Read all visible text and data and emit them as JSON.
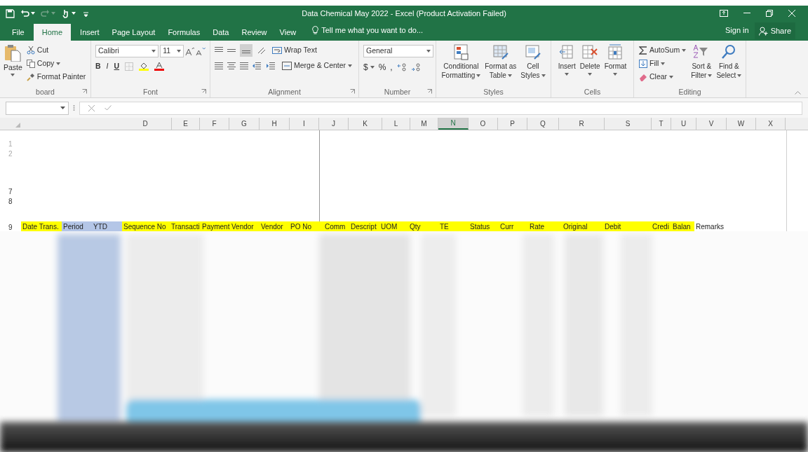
{
  "window": {
    "title": "Data Chemical May 2022 - Excel (Product Activation Failed)"
  },
  "quick_access": [
    {
      "kind": "save",
      "disabled": false
    },
    {
      "kind": "undo",
      "disabled": false
    },
    {
      "kind": "redo",
      "disabled": true
    },
    {
      "kind": "touch",
      "disabled": false
    },
    {
      "kind": "customize",
      "disabled": false
    }
  ],
  "tabs": [
    {
      "label": "File",
      "selected": false
    },
    {
      "label": "Home",
      "selected": true
    },
    {
      "label": "Insert",
      "selected": false
    },
    {
      "label": "Page Layout",
      "selected": false
    },
    {
      "label": "Formulas",
      "selected": false
    },
    {
      "label": "Data",
      "selected": false
    },
    {
      "label": "Review",
      "selected": false
    },
    {
      "label": "View",
      "selected": false
    }
  ],
  "tell_me": "Tell me what you want to do...",
  "sign_in": "Sign in",
  "share": "Share",
  "ribbon": {
    "clipboard": {
      "paste": "Paste",
      "cut": "Cut",
      "copy": "Copy",
      "format_painter": "Format Painter",
      "label": "board"
    },
    "font": {
      "font_name": "Calibri",
      "font_size": "11",
      "bold": "B",
      "italic": "I",
      "underline": "U",
      "label": "Font"
    },
    "alignment": {
      "wrap_text": "Wrap Text",
      "merge_center": "Merge & Center",
      "label": "Alignment"
    },
    "number": {
      "format": "General",
      "currency": "$",
      "percent": "%",
      "comma": ",",
      "label": "Number"
    },
    "styles": {
      "buttons": [
        {
          "kind": "conditional",
          "lines": [
            "Conditional",
            "Formatting"
          ],
          "dropdown": true
        },
        {
          "kind": "table",
          "lines": [
            "Format as",
            "Table"
          ],
          "dropdown": true
        },
        {
          "kind": "cellstyles",
          "lines": [
            "Cell",
            "Styles"
          ],
          "dropdown": true
        }
      ],
      "label": "Styles"
    },
    "cells": {
      "buttons": [
        {
          "kind": "insert",
          "lines": [
            "Insert"
          ],
          "dropdown": true
        },
        {
          "kind": "delete",
          "lines": [
            "Delete"
          ],
          "dropdown": true
        },
        {
          "kind": "format",
          "lines": [
            "Format"
          ],
          "dropdown": true
        }
      ],
      "label": "Cells"
    },
    "editing": {
      "autosum": "AutoSum",
      "fill": "Fill",
      "clear": "Clear",
      "buttons": [
        {
          "kind": "sort",
          "lines": [
            "Sort &",
            "Filter"
          ],
          "dropdown": true
        },
        {
          "kind": "find",
          "lines": [
            "Find &",
            "Select"
          ],
          "dropdown": true
        }
      ],
      "label": "Editing"
    }
  },
  "columns": [
    {
      "label": "D",
      "selected": false
    },
    {
      "label": "E",
      "selected": false
    },
    {
      "label": "F",
      "selected": false
    },
    {
      "label": "G",
      "selected": false
    },
    {
      "label": "H",
      "selected": false
    },
    {
      "label": "I",
      "selected": false
    },
    {
      "label": "J",
      "selected": false
    },
    {
      "label": "K",
      "selected": false
    },
    {
      "label": "L",
      "selected": false
    },
    {
      "label": "M",
      "selected": false
    },
    {
      "label": "N",
      "selected": true
    },
    {
      "label": "O",
      "selected": false
    },
    {
      "label": "P",
      "selected": false
    },
    {
      "label": "Q",
      "selected": false
    },
    {
      "label": "R",
      "selected": false
    },
    {
      "label": "S",
      "selected": false
    },
    {
      "label": "T",
      "selected": false
    },
    {
      "label": "U",
      "selected": false
    },
    {
      "label": "V",
      "selected": false
    },
    {
      "label": "W",
      "selected": false
    },
    {
      "label": "X",
      "selected": false
    }
  ],
  "row_numbers": [
    "1",
    "2",
    "7",
    "8",
    "9"
  ],
  "header_row": [
    {
      "text": "Date Trans.",
      "color": "#ffff00"
    },
    {
      "text": "Period",
      "color": "#b4c6e7"
    },
    {
      "text": "YTD",
      "color": "#b4c6e7"
    },
    {
      "text": "Sequence No",
      "color": "#ffff00"
    },
    {
      "text": "Transacti",
      "color": "#ffff00"
    },
    {
      "text": "Payment",
      "color": "#ffff00"
    },
    {
      "text": "Vendor",
      "color": "#ffff00"
    },
    {
      "text": "Vendor",
      "color": "#ffff00"
    },
    {
      "text": "PO No",
      "color": "#ffff00"
    },
    {
      "text": "Comm",
      "color": "#ffff00"
    },
    {
      "text": "Descript",
      "color": "#ffff00"
    },
    {
      "text": "UOM",
      "color": "#ffff00"
    },
    {
      "text": "Qty",
      "color": "#ffff00"
    },
    {
      "text": "TE",
      "color": "#ffff00"
    },
    {
      "text": "Status",
      "color": "#ffff00"
    },
    {
      "text": "Curr",
      "color": "#ffff00"
    },
    {
      "text": "Rate",
      "color": "#ffff00"
    },
    {
      "text": "Original",
      "color": "#ffff00"
    },
    {
      "text": "Debit",
      "color": "#ffff00"
    },
    {
      "text": "Credi",
      "color": "#ffff00"
    },
    {
      "text": "Balan",
      "color": "#ffff00"
    },
    {
      "text": "Remarks",
      "color": "#ffffff"
    }
  ]
}
